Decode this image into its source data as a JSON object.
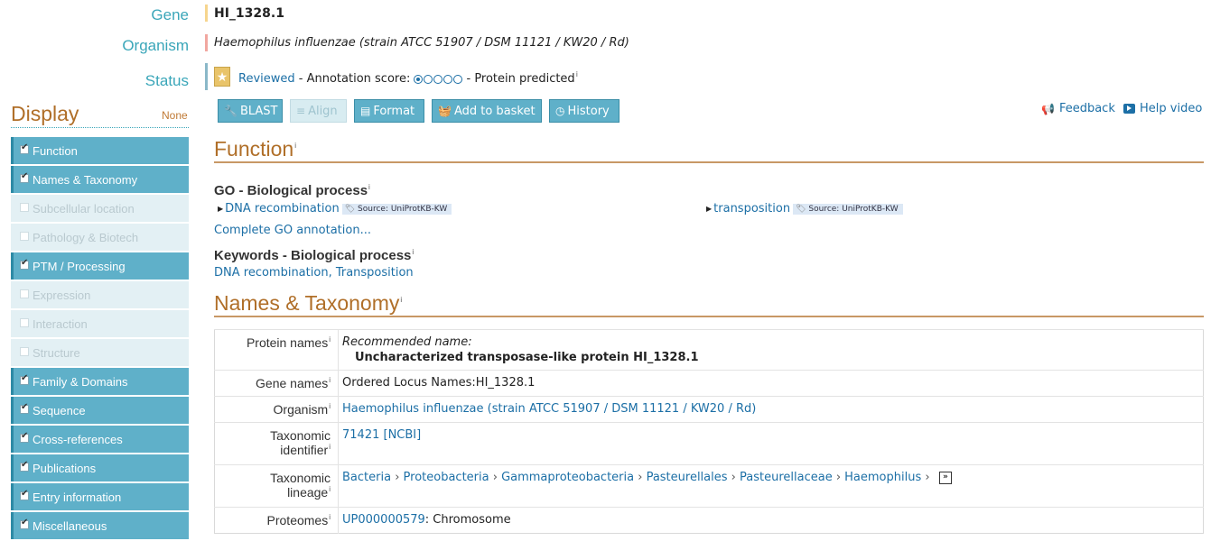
{
  "entry": {
    "gene_label": "Gene",
    "gene_value": "HI_1328.1",
    "organism_label": "Organism",
    "organism_value": "Haemophilus influenzae (strain ATCC 51907 / DSM 11121 / KW20 / Rd)",
    "status_label": "Status",
    "status_reviewed": "Reviewed",
    "status_sep1": " - ",
    "annotation_label": "Annotation score:",
    "annotation_score": 1,
    "annotation_max": 5,
    "status_sep2": " - ",
    "protein_status": "Protein predicted"
  },
  "display": {
    "title": "Display",
    "none_label": "None",
    "items": [
      {
        "label": "Function",
        "checked": true
      },
      {
        "label": "Names & Taxonomy",
        "checked": true
      },
      {
        "label": "Subcellular location",
        "checked": false
      },
      {
        "label": "Pathology & Biotech",
        "checked": false
      },
      {
        "label": "PTM / Processing",
        "checked": true
      },
      {
        "label": "Expression",
        "checked": false
      },
      {
        "label": "Interaction",
        "checked": false
      },
      {
        "label": "Structure",
        "checked": false
      },
      {
        "label": "Family & Domains",
        "checked": true
      },
      {
        "label": "Sequence",
        "checked": true
      },
      {
        "label": "Cross-references",
        "checked": true
      },
      {
        "label": "Publications",
        "checked": true
      },
      {
        "label": "Entry information",
        "checked": true
      },
      {
        "label": "Miscellaneous",
        "checked": true
      }
    ]
  },
  "toolbar": {
    "blast": "BLAST",
    "align": "Align",
    "format": "Format",
    "add_to_basket": "Add to basket",
    "history": "History",
    "feedback": "Feedback",
    "help_video": "Help video"
  },
  "function": {
    "title": "Function",
    "go_bp_title": "GO - Biological process",
    "go_terms": [
      {
        "term": "DNA recombination",
        "source": "Source: UniProtKB-KW"
      },
      {
        "term": "transposition",
        "source": "Source: UniProtKB-KW"
      }
    ],
    "complete_go": "Complete GO annotation...",
    "kw_bp_title": "Keywords - Biological process",
    "keywords": [
      "DNA recombination",
      "Transposition"
    ],
    "keyword_sep": ", "
  },
  "names": {
    "title": "Names & Taxonomy",
    "protein_names_label": "Protein names",
    "recommended_label": "Recommended name:",
    "recommended_value": "Uncharacterized transposase-like protein HI_1328.1",
    "gene_names_label": "Gene names",
    "gene_names_value": "Ordered Locus Names:HI_1328.1",
    "organism_label": "Organism",
    "organism_value": "Haemophilus influenzae (strain ATCC 51907 / DSM 11121 / KW20 / Rd)",
    "taxid_label_1": "Taxonomic",
    "taxid_label_2": "identifier",
    "taxid_value": "71421",
    "taxid_ncbi": "[NCBI]",
    "lineage_label_1": "Taxonomic",
    "lineage_label_2": "lineage",
    "lineage": [
      "Bacteria",
      "Proteobacteria",
      "Gammaproteobacteria",
      "Pasteurellales",
      "Pasteurellaceae",
      "Haemophilus"
    ],
    "lineage_sep": " › ",
    "proteomes_label": "Proteomes",
    "proteome_id": "UP000000579",
    "proteome_desc": ": Chromosome"
  },
  "info_marker": "i",
  "colors": {
    "accent": "#3aa6b9",
    "section_title": "#b06f29",
    "button": "#5fb0c9",
    "link": "#1c6fa6",
    "gene_bar": "#f6d58e",
    "organism_bar": "#f1a7a0",
    "status_bar": "#8ab8c8"
  }
}
